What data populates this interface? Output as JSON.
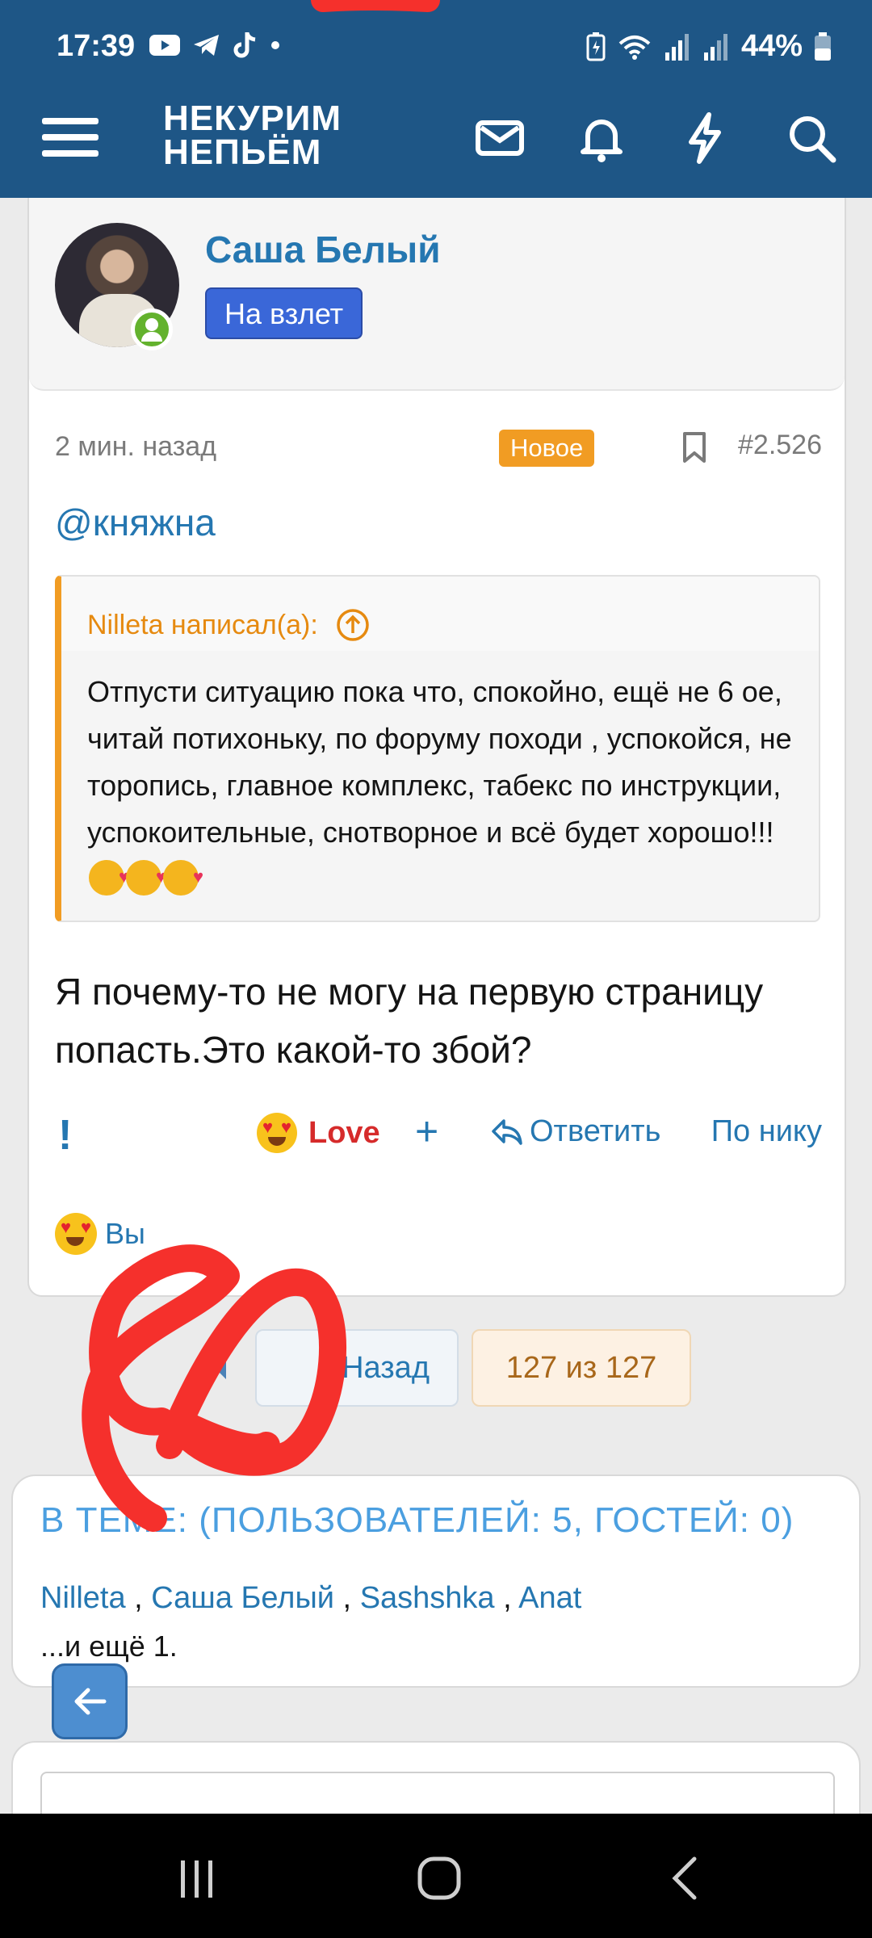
{
  "status_bar": {
    "time": "17:39",
    "battery": "44%"
  },
  "header": {
    "logo_line1": "НЕКУРИМ",
    "logo_line2": "НЕПЬЁМ"
  },
  "post": {
    "author_name": "Саша Белый",
    "author_badge": "На взлет",
    "time_ago": "2 мин. назад",
    "new_label": "Новое",
    "post_number": "#2.526",
    "mention": "@княжна",
    "quote_author": "Nilleta написал(а):",
    "quote_text": "Отпусти ситуацию пока что, спокойно, ещё не 6 ое, читай потихоньку, по форуму походи , успокойся, не торопись, главное комплекс, табекс по инструкции, успокоительные, снотворное и всё будет хорошо!!!",
    "message": "Я почему-то не могу на первую страницу попасть.Это какой-то збой?",
    "actions": {
      "report": "!",
      "love": "Love",
      "plus": "+",
      "reply": "Ответить",
      "by_nick": "По нику"
    },
    "reaction_by": "Вы"
  },
  "pagination": {
    "back": "Назад",
    "position": "127 из 127"
  },
  "online": {
    "title": "В ТЕМЕ: (ПОЛЬЗОВАТЕЛЕЙ: 5, ГОСТЕЙ: 0)",
    "users": [
      "Nilleta",
      "Саша Белый",
      "Sashshka",
      "Anat"
    ],
    "more": "...и ещё 1."
  },
  "colors": {
    "header_bg": "#1e5686",
    "link": "#2577b1",
    "accent_orange": "#f19c23",
    "badge_blue": "#3a67d8",
    "love_red": "#d62b2b"
  }
}
